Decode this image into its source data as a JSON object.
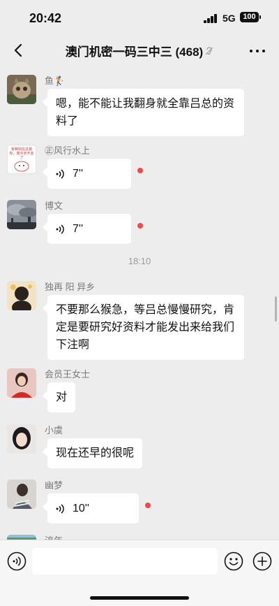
{
  "status_bar": {
    "time": "20:42",
    "network": "5G",
    "battery": "100"
  },
  "header": {
    "title": "澳门机密一码三中三 (468)",
    "back_icon": "chevron-left-icon",
    "mute_icon": "mute-ear-icon",
    "more_icon": "more-dots-icon"
  },
  "chat": {
    "messages": [
      {
        "sender": "鱼🏌",
        "type": "text",
        "text": "嗯，能不能让我翻身就全靠吕总的资料了",
        "avatar": "cat-avatar"
      },
      {
        "sender": "㊣风行水上",
        "type": "voice",
        "duration": "7''",
        "unread": true,
        "avatar": "sticker-avatar",
        "avatar_text": "有种别在这装你，我今天不去了"
      },
      {
        "sender": "博文",
        "type": "voice",
        "duration": "7''",
        "unread": true,
        "avatar": "cloudy-sky-avatar"
      },
      {
        "sender": "独再 阳 异乡",
        "type": "text",
        "text": "不要那么猴急，等吕总慢慢研究，肯定是要研究好资料才能发出来给我们下注啊",
        "avatar": "girl-avatar"
      },
      {
        "sender": "会员王女士",
        "type": "text",
        "text": "对",
        "avatar": "woman-red-avatar"
      },
      {
        "sender": "小虞",
        "type": "text",
        "text": "现在还早的很呢",
        "avatar": "girl-portrait-avatar"
      },
      {
        "sender": "幽梦",
        "type": "voice",
        "duration": "10''",
        "unread": true,
        "avatar": "person-avatar"
      },
      {
        "sender": "流年",
        "type": "text",
        "text": "",
        "avatar": "landscape-avatar"
      }
    ],
    "time_separator": "18:10"
  },
  "input_bar": {
    "voice_icon": "voice-input-icon",
    "emoji_icon": "emoji-icon",
    "plus_icon": "plus-icon"
  },
  "colors": {
    "background": "#ededed",
    "bubble": "#ffffff",
    "unread_dot": "#f04a4a",
    "name": "#7b7b7b"
  }
}
